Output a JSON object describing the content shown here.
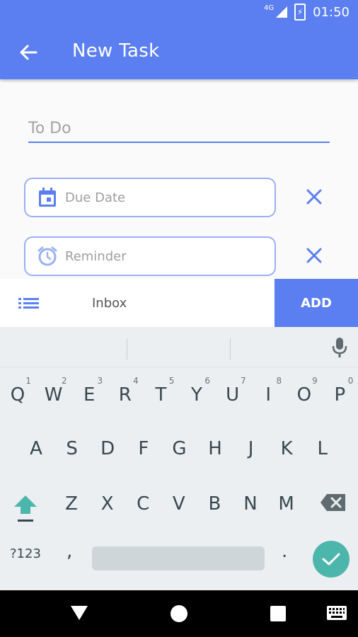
{
  "status_bar": {
    "network": "4G",
    "time": "01:50"
  },
  "app_bar": {
    "title": "New Task"
  },
  "form": {
    "todo_placeholder": "To Do",
    "due_date_placeholder": "Due Date",
    "reminder_placeholder": "Reminder"
  },
  "bottom_bar": {
    "list_label": "Inbox",
    "add_label": "ADD"
  },
  "keyboard": {
    "row1": [
      {
        "k": "Q",
        "n": "1"
      },
      {
        "k": "W",
        "n": "2"
      },
      {
        "k": "E",
        "n": "3"
      },
      {
        "k": "R",
        "n": "4"
      },
      {
        "k": "T",
        "n": "5"
      },
      {
        "k": "Y",
        "n": "6"
      },
      {
        "k": "U",
        "n": "7"
      },
      {
        "k": "I",
        "n": "8"
      },
      {
        "k": "O",
        "n": "9"
      },
      {
        "k": "P",
        "n": "0"
      }
    ],
    "row2": [
      "A",
      "S",
      "D",
      "F",
      "G",
      "H",
      "J",
      "K",
      "L"
    ],
    "row3": [
      "Z",
      "X",
      "C",
      "V",
      "B",
      "N",
      "M"
    ],
    "symbols_label": "?123",
    "comma": ",",
    "period": "."
  },
  "colors": {
    "primary": "#5b7ff0",
    "field_border": "#9bb0f5",
    "enter": "#4db6ac"
  }
}
